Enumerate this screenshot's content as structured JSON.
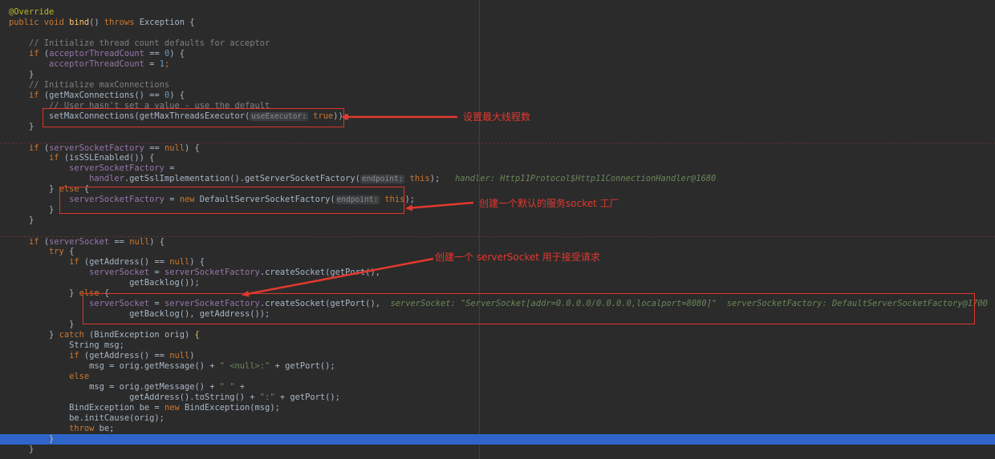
{
  "editor": {
    "language": "java",
    "colors": {
      "background": "#2b2b2b",
      "keyword": "#cc7832",
      "method": "#ffc66d",
      "field": "#9876aa",
      "number": "#6897bb",
      "comment": "#808080",
      "annotation": "#bbb529",
      "debug_hint": "#6a8759",
      "current_line": "#2f65ca",
      "callout": "#e2392f"
    },
    "lines": [
      [
        [
          "@Override",
          "ann"
        ]
      ],
      [
        [
          "public ",
          "kw"
        ],
        [
          "void ",
          "kw"
        ],
        [
          "bind",
          "fn"
        ],
        [
          "() ",
          ""
        ],
        [
          "throws ",
          "kw"
        ],
        [
          "Exception {",
          ""
        ]
      ],
      [
        [
          "",
          ""
        ]
      ],
      [
        [
          "    ",
          ""
        ],
        [
          "// Initialize thread count defaults for acceptor",
          "cmt"
        ]
      ],
      [
        [
          "    ",
          ""
        ],
        [
          "if ",
          "kw"
        ],
        [
          "(",
          ""
        ],
        [
          "acceptorThreadCount",
          "fld"
        ],
        [
          " == ",
          ""
        ],
        [
          "0",
          "num"
        ],
        [
          ") {",
          ""
        ]
      ],
      [
        [
          "        ",
          ""
        ],
        [
          "acceptorThreadCount",
          "fld"
        ],
        [
          " = ",
          ""
        ],
        [
          "1",
          "num"
        ],
        [
          ";",
          "kw"
        ]
      ],
      [
        [
          "    }",
          ""
        ]
      ],
      [
        [
          "    ",
          ""
        ],
        [
          "// Initialize maxConnections",
          "cmt"
        ]
      ],
      [
        [
          "    ",
          ""
        ],
        [
          "if ",
          "kw"
        ],
        [
          "(getMaxConnections() == ",
          ""
        ],
        [
          "0",
          "num"
        ],
        [
          ") {",
          ""
        ]
      ],
      [
        [
          "        ",
          ""
        ],
        [
          "// User hasn't set a value - use the default",
          "cmt"
        ]
      ],
      [
        [
          "        setMaxConnections(getMaxThreadsExecutor(",
          ""
        ],
        [
          "useExecutor:",
          "badge"
        ],
        [
          " ",
          ""
        ],
        [
          "true",
          "kw"
        ],
        [
          "));",
          ""
        ]
      ],
      [
        [
          "    }",
          ""
        ]
      ],
      [
        [
          "",
          ""
        ]
      ],
      [
        [
          "    ",
          ""
        ],
        [
          "if ",
          "kw"
        ],
        [
          "(",
          ""
        ],
        [
          "serverSocketFactory",
          "fld"
        ],
        [
          " == ",
          ""
        ],
        [
          "null",
          "kw"
        ],
        [
          ") {",
          ""
        ]
      ],
      [
        [
          "        ",
          ""
        ],
        [
          "if ",
          "kw"
        ],
        [
          "(isSSLEnabled()) {",
          ""
        ]
      ],
      [
        [
          "            ",
          ""
        ],
        [
          "serverSocketFactory",
          "fld"
        ],
        [
          " =",
          ""
        ]
      ],
      [
        [
          "                ",
          ""
        ],
        [
          "handler",
          "fld"
        ],
        [
          ".getSslImplementation().getServerSocketFactory(",
          ""
        ],
        [
          "endpoint:",
          "badge"
        ],
        [
          " ",
          ""
        ],
        [
          "this",
          "kw"
        ],
        [
          ");",
          ""
        ],
        [
          "   handler: Http11Protocol$Http11ConnectionHandler@1680",
          "hint"
        ]
      ],
      [
        [
          "        } ",
          ""
        ],
        [
          "else ",
          "kw"
        ],
        [
          "{",
          ""
        ]
      ],
      [
        [
          "            ",
          ""
        ],
        [
          "serverSocketFactory",
          "fld"
        ],
        [
          " = ",
          ""
        ],
        [
          "new ",
          "kw"
        ],
        [
          "DefaultServerSocketFactory(",
          ""
        ],
        [
          "endpoint:",
          "badge"
        ],
        [
          " ",
          ""
        ],
        [
          "this",
          "kw"
        ],
        [
          ");",
          ""
        ]
      ],
      [
        [
          "        }",
          ""
        ]
      ],
      [
        [
          "    }",
          ""
        ]
      ],
      [
        [
          "",
          ""
        ]
      ],
      [
        [
          "    ",
          ""
        ],
        [
          "if ",
          "kw"
        ],
        [
          "(",
          ""
        ],
        [
          "serverSocket",
          "fld"
        ],
        [
          " == ",
          ""
        ],
        [
          "null",
          "kw"
        ],
        [
          ") {",
          ""
        ]
      ],
      [
        [
          "        ",
          ""
        ],
        [
          "try ",
          "kw"
        ],
        [
          "{",
          ""
        ]
      ],
      [
        [
          "            ",
          ""
        ],
        [
          "if ",
          "kw"
        ],
        [
          "(getAddress() == ",
          ""
        ],
        [
          "null",
          "kw"
        ],
        [
          ") {",
          ""
        ]
      ],
      [
        [
          "                ",
          ""
        ],
        [
          "serverSocket",
          "fld"
        ],
        [
          " = ",
          ""
        ],
        [
          "serverSocketFactory",
          "fld"
        ],
        [
          ".createSocket(getPort(),",
          ""
        ]
      ],
      [
        [
          "                        getBacklog());",
          ""
        ]
      ],
      [
        [
          "            } ",
          ""
        ],
        [
          "else ",
          "kw"
        ],
        [
          "{",
          ""
        ]
      ],
      [
        [
          "                ",
          ""
        ],
        [
          "serverSocket",
          "fld"
        ],
        [
          " = ",
          ""
        ],
        [
          "serverSocketFactory",
          "fld"
        ],
        [
          ".createSocket(getPort(),",
          ""
        ],
        [
          "  serverSocket: \"ServerSocket[addr=0.0.0.0/0.0.0.0,localport=8080]\"  serverSocketFactory: DefaultServerSocketFactory@1700",
          "hint"
        ]
      ],
      [
        [
          "                        getBacklog(), getAddress());",
          ""
        ]
      ],
      [
        [
          "            }",
          ""
        ]
      ],
      [
        [
          "        } ",
          ""
        ],
        [
          "catch ",
          "kw"
        ],
        [
          "(BindException orig) ",
          ""
        ],
        [
          "{",
          "brace"
        ]
      ],
      [
        [
          "            String msg;",
          ""
        ]
      ],
      [
        [
          "            ",
          ""
        ],
        [
          "if ",
          "kw"
        ],
        [
          "(getAddress() == ",
          ""
        ],
        [
          "null",
          "kw"
        ],
        [
          ")",
          ""
        ]
      ],
      [
        [
          "                msg = orig.getMessage() + ",
          ""
        ],
        [
          "\" <null>:\"",
          "str"
        ],
        [
          " + getPort();",
          ""
        ]
      ],
      [
        [
          "            ",
          ""
        ],
        [
          "else",
          "kw"
        ]
      ],
      [
        [
          "                msg = orig.getMessage() + ",
          ""
        ],
        [
          "\" \"",
          "str"
        ],
        [
          " +",
          ""
        ]
      ],
      [
        [
          "                        getAddress().toString() + ",
          ""
        ],
        [
          "\":\"",
          "str"
        ],
        [
          " + getPort();",
          ""
        ]
      ],
      [
        [
          "            BindException be = ",
          ""
        ],
        [
          "new ",
          "kw"
        ],
        [
          "BindException(msg);",
          ""
        ]
      ],
      [
        [
          "            be.initCause(orig);",
          ""
        ]
      ],
      [
        [
          "            ",
          ""
        ],
        [
          "throw ",
          "kw"
        ],
        [
          "be;",
          ""
        ]
      ],
      [
        [
          "        ",
          ""
        ],
        [
          "}",
          "brace"
        ]
      ],
      [
        [
          "    }",
          ""
        ]
      ]
    ]
  },
  "annotations": [
    {
      "text": "设置最大线程数"
    },
    {
      "text": "创建一个默认的服务socket 工厂"
    },
    {
      "text": "创建一个 serverSocket 用于接受请求"
    }
  ]
}
